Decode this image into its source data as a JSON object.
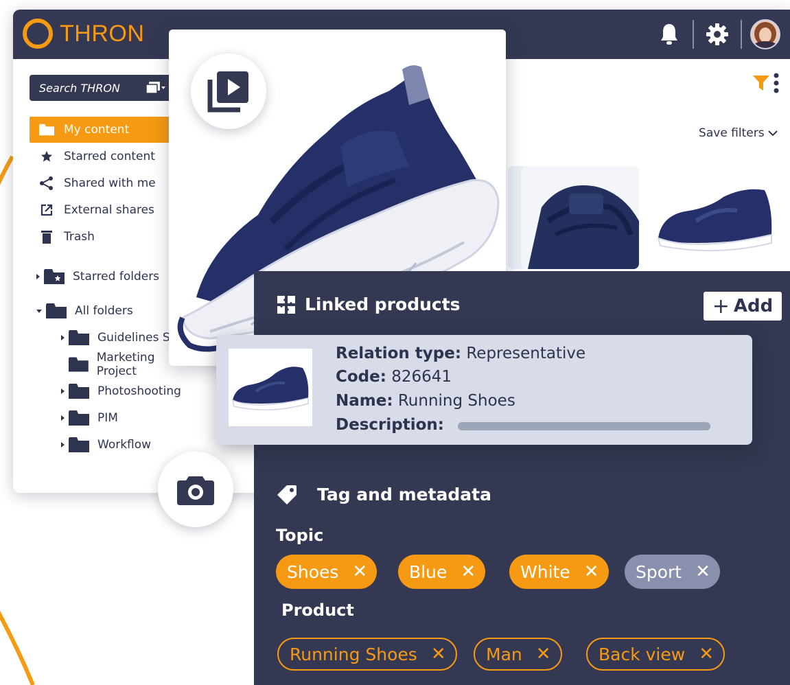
{
  "header": {
    "logo_text": "THRON",
    "icons": [
      "bell-icon",
      "gear-icon",
      "avatar"
    ]
  },
  "search": {
    "placeholder": "Search THRON"
  },
  "sidebar": {
    "items": [
      {
        "label": "My content",
        "icon": "folder-icon",
        "active": true
      },
      {
        "label": "Starred content",
        "icon": "star-icon"
      },
      {
        "label": "Shared with me",
        "icon": "share-icon"
      },
      {
        "label": "External shares",
        "icon": "external-link-icon"
      },
      {
        "label": "Trash",
        "icon": "trash-icon"
      }
    ],
    "starred_folders": "Starred folders",
    "all_folders": "All folders",
    "folders": [
      "Guidelines Sho",
      "Marketing Project",
      "Photoshooting",
      "PIM",
      "Workflow"
    ]
  },
  "toolbar": {
    "save_filters": "Save filters"
  },
  "panel": {
    "linked_products_title": "Linked products",
    "add_label": "Add",
    "product": {
      "relation_type_label": "Relation type:",
      "relation_type_value": "Representative",
      "code_label": "Code:",
      "code_value": "826641",
      "name_label": "Name:",
      "name_value": "Running Shoes",
      "description_label": "Description:"
    },
    "tag_section_title": "Tag and metadata",
    "topic_label": "Topic",
    "topic_tags": [
      "Shoes",
      "Blue",
      "White",
      "Sport"
    ],
    "product_label": "Product",
    "product_tags": [
      "Running Shoes",
      "Man",
      "Back view"
    ]
  },
  "colors": {
    "accent": "#f59a12",
    "navy": "#343852",
    "muted_chip": "#8a8fae",
    "card": "#d8dbe8"
  }
}
